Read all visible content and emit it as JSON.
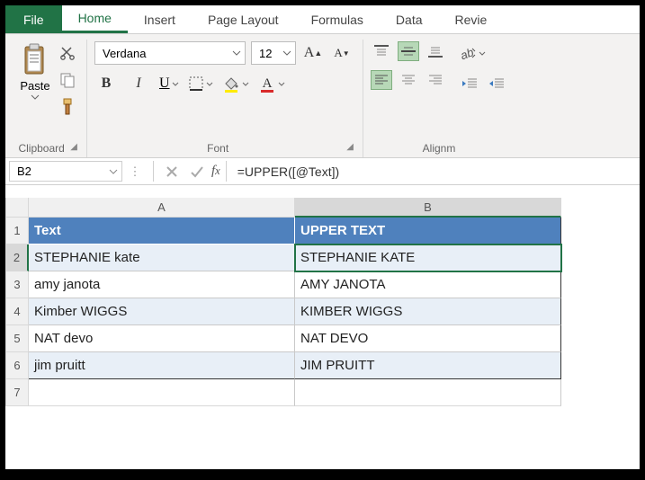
{
  "tabs": {
    "file": "File",
    "home": "Home",
    "insert": "Insert",
    "page_layout": "Page Layout",
    "formulas": "Formulas",
    "data": "Data",
    "review": "Revie"
  },
  "ribbon": {
    "clipboard": {
      "paste": "Paste",
      "label": "Clipboard"
    },
    "font": {
      "name": "Verdana",
      "size": "12",
      "bold": "B",
      "italic": "I",
      "underline": "U",
      "label": "Font"
    },
    "alignment": {
      "label": "Alignm"
    }
  },
  "name_box": "B2",
  "formula": "=UPPER([@Text])",
  "columns": {
    "A": "A",
    "B": "B"
  },
  "rows": [
    "1",
    "2",
    "3",
    "4",
    "5",
    "6",
    "7"
  ],
  "table": {
    "headers": {
      "A": "Text",
      "B": "UPPER TEXT"
    },
    "rows": [
      {
        "A": "STEPHANIE kate",
        "B": "STEPHANIE KATE"
      },
      {
        "A": "amy janota",
        "B": "AMY JANOTA"
      },
      {
        "A": "Kimber WIGGS",
        "B": "KIMBER WIGGS"
      },
      {
        "A": "NAT devo",
        "B": "NAT DEVO"
      },
      {
        "A": "jim pruitt",
        "B": "JIM PRUITT"
      }
    ]
  }
}
